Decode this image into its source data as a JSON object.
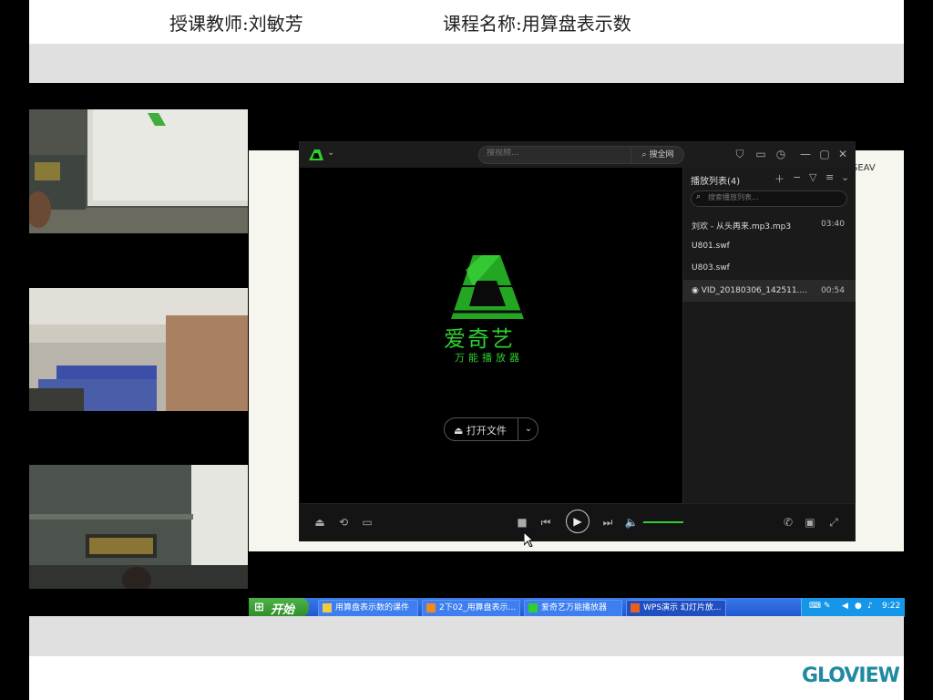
{
  "header": {
    "teacher": "授课教师:刘敏芳",
    "course": "课程名称:用算盘表示数"
  },
  "player": {
    "search_placeholder": "搜视频...",
    "search_button": "搜全网",
    "brand_name": "爱奇艺",
    "brand_subtitle": "万能播放器",
    "open_file": "打开文件",
    "playlist": {
      "title": "播放列表(4)",
      "search_placeholder": "搜索播放列表...",
      "items": [
        {
          "name": "刘欢 - 从头再来.mp3.mp3",
          "duration": "03:40"
        },
        {
          "name": "U801.swf",
          "duration": ""
        },
        {
          "name": "U803.swf",
          "duration": ""
        },
        {
          "name": "VID_20180306_142511....",
          "duration": "00:54"
        }
      ],
      "selected_index": 3
    },
    "volume_level": 1.0,
    "accent_color": "#2fcf2f"
  },
  "taskbar": {
    "start_label": "开始",
    "items": [
      {
        "label": "用算盘表示数的课件"
      },
      {
        "label": "2下02_用算盘表示..."
      },
      {
        "label": "爱奇艺万能播放器"
      },
      {
        "label": "WPS演示 幻灯片放..."
      }
    ],
    "clock": "9:22"
  },
  "branding": {
    "watermark": "GLOVIEW",
    "slide_logo_text": "SEAV"
  }
}
